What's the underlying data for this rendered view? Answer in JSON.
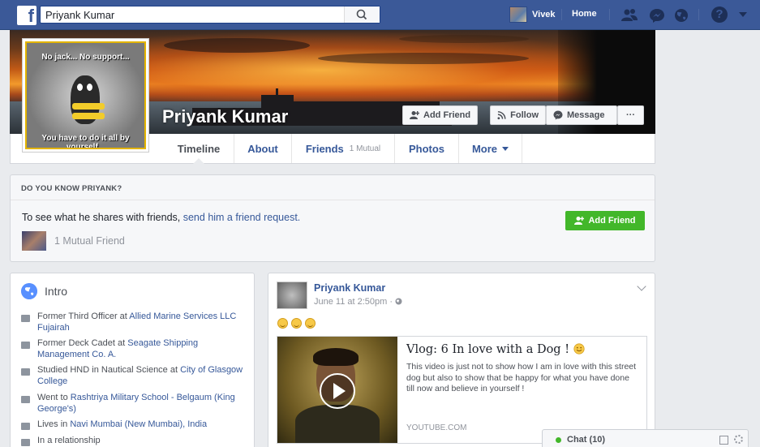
{
  "topbar": {
    "logo": "f",
    "search_value": "Priyank Kumar",
    "user_name": "Vivek",
    "home_label": "Home",
    "help_label": "?"
  },
  "profile": {
    "name": "Priyank Kumar",
    "picture_text_top": "No jack... No support...",
    "picture_text_bottom": "You have to do it all by yourself...",
    "buttons": {
      "add_friend": "Add Friend",
      "follow": "Follow",
      "message": "Message",
      "more": "···"
    }
  },
  "tabs": [
    {
      "label": "Timeline",
      "sub": ""
    },
    {
      "label": "About",
      "sub": ""
    },
    {
      "label": "Friends",
      "sub": "1 Mutual"
    },
    {
      "label": "Photos",
      "sub": ""
    },
    {
      "label": "More",
      "sub": ""
    }
  ],
  "know": {
    "heading": "DO YOU KNOW PRIYANK?",
    "text": "To see what he shares with friends,",
    "link": "send him a friend request.",
    "button": "Add Friend",
    "mutual": "1 Mutual Friend"
  },
  "intro": {
    "title": "Intro",
    "items": [
      {
        "prefix": "Former Third Officer at ",
        "link": "Allied Marine Services LLC Fujairah",
        "suffix": ""
      },
      {
        "prefix": "Former Deck Cadet at ",
        "link": "Seagate Shipping Management Co. A.",
        "suffix": ""
      },
      {
        "prefix": "Studied HND in Nautical Science at ",
        "link": "City of Glasgow College",
        "suffix": ""
      },
      {
        "prefix": "Went to ",
        "link": "Rashtriya Military School - Belgaum (King George's)",
        "suffix": ""
      },
      {
        "prefix": "Lives in ",
        "link": "Navi Mumbai (New Mumbai), India",
        "suffix": ""
      },
      {
        "prefix": "In a relationship",
        "link": "",
        "suffix": ""
      }
    ]
  },
  "post": {
    "author": "Priyank Kumar",
    "time": "June 11 at 2:50pm · ",
    "video_title": "Vlog: 6 In love with a Dog !",
    "video_desc": "This video is just not to show how I am in love with this street dog but also to show that be happy for what you have done till now and believe in yourself !",
    "source": "YOUTUBE.COM"
  },
  "chat": {
    "label": "Chat (10)"
  },
  "colors": {
    "brand": "#3b5998",
    "link": "#365899",
    "green": "#42b72a"
  }
}
